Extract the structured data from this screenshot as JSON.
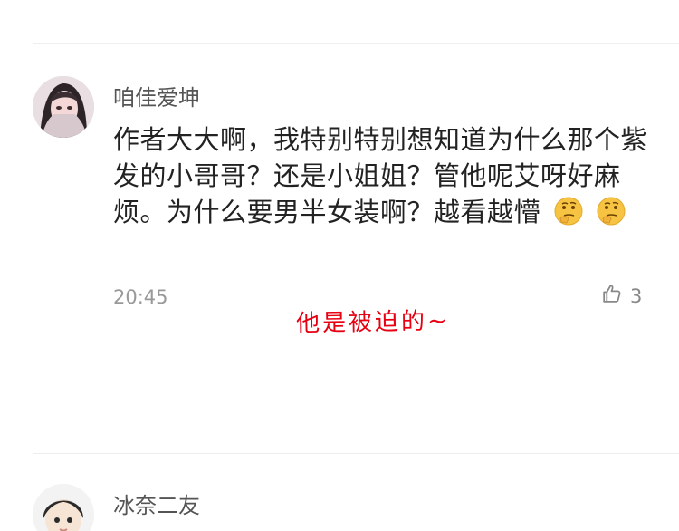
{
  "comments": [
    {
      "username": "咱佳爱坤",
      "text": "作者大大啊，我特别特别想知道为什么那个紫发的小哥哥？还是小姐姐？管他呢艾呀好麻烦。为什么要男半女装啊？越看越懵",
      "emojis": [
        "thinking-face",
        "thinking-face"
      ],
      "time": "20:45",
      "like_count": "3"
    },
    {
      "username": "冰奈二友"
    }
  ],
  "annotation": {
    "text": "他是被迫的~",
    "color": "#e60012"
  },
  "icons": {
    "like": "thumbs-up-icon"
  }
}
